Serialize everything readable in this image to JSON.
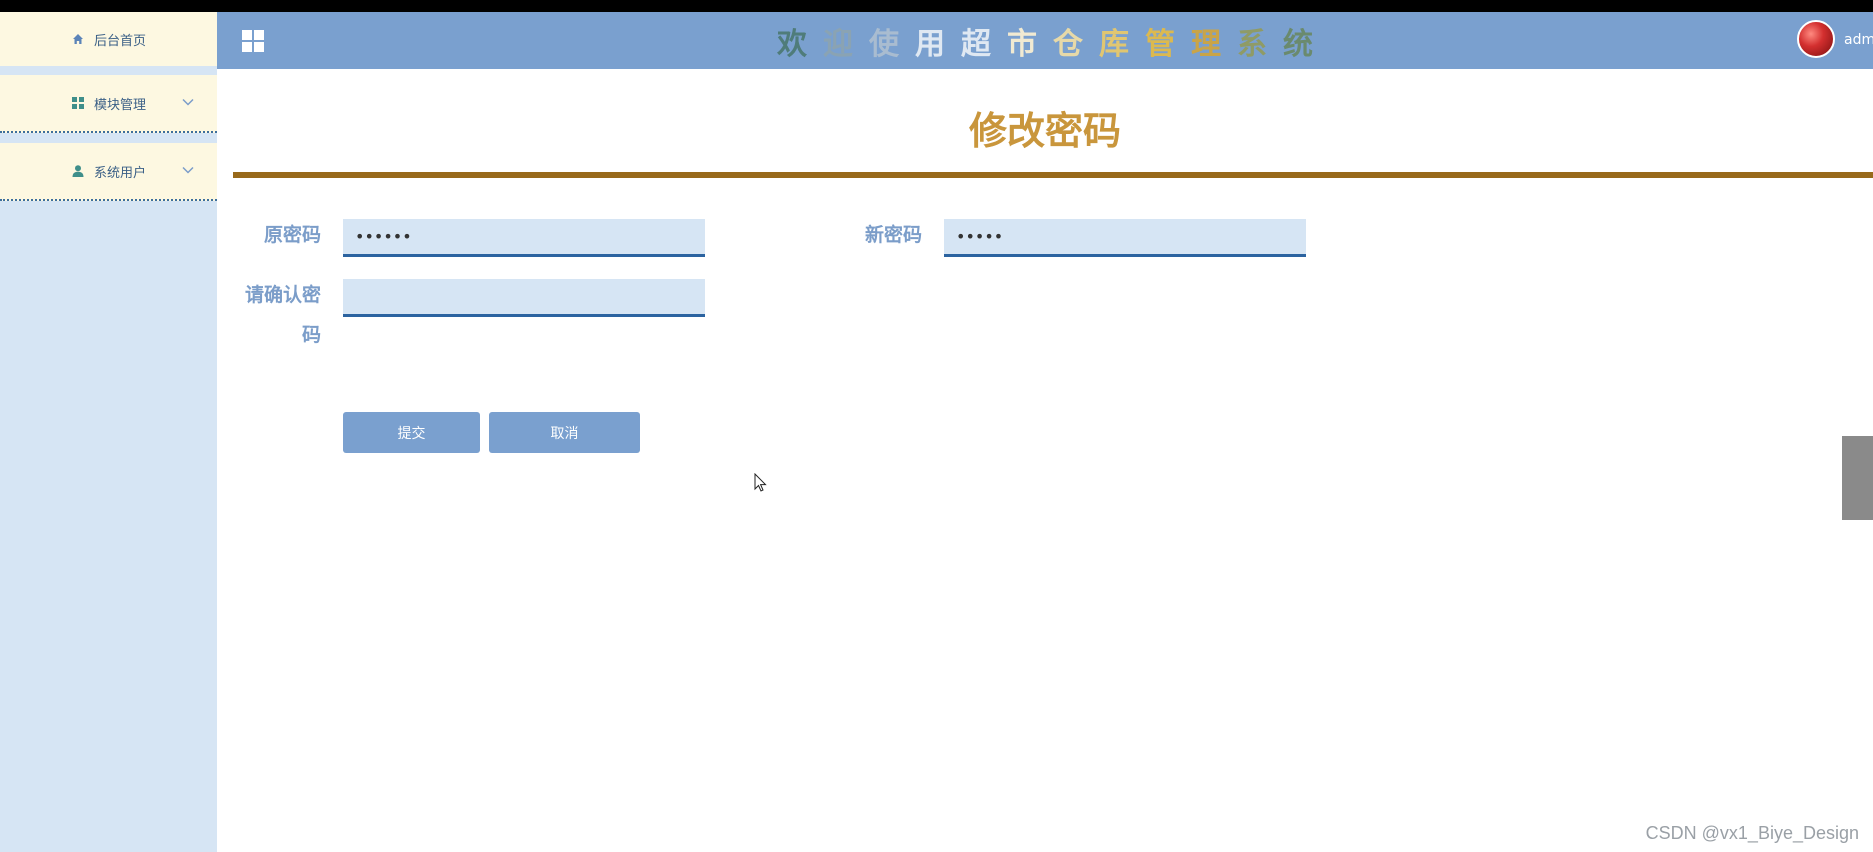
{
  "sidebar": {
    "items": [
      {
        "label": "后台首页",
        "icon": "home-icon"
      },
      {
        "label": "模块管理",
        "icon": "grid-icon"
      },
      {
        "label": "系统用户",
        "icon": "user-icon"
      }
    ]
  },
  "header": {
    "welcome_chars": [
      {
        "ch": "欢",
        "color": "#4f7c7a"
      },
      {
        "ch": "迎",
        "color": "#8aa3b3"
      },
      {
        "ch": "使",
        "color": "#a9bcd0"
      },
      {
        "ch": "用",
        "color": "#dfe8f2"
      },
      {
        "ch": "超",
        "color": "#dfe8f2"
      },
      {
        "ch": "市",
        "color": "#f1ead2"
      },
      {
        "ch": "仓",
        "color": "#e7d9a8"
      },
      {
        "ch": "库",
        "color": "#e0c671"
      },
      {
        "ch": "管",
        "color": "#dcb94f"
      },
      {
        "ch": "理",
        "color": "#c9a448"
      },
      {
        "ch": "系",
        "color": "#8f9b66"
      },
      {
        "ch": "统",
        "color": "#6a8a6e"
      }
    ],
    "username": "admi"
  },
  "form": {
    "title": "修改密码",
    "old_password_label": "原密码",
    "old_password_value": "••••••",
    "new_password_label": "新密码",
    "new_password_value": "•••••",
    "confirm_label_line1": "请确认密",
    "confirm_label_line2": "码",
    "confirm_value": "",
    "submit_label": "提交",
    "cancel_label": "取消"
  },
  "watermark": "CSDN @vx1_Biye_Design",
  "colors": {
    "header_bg": "#7aa0cf",
    "sidebar_bg": "#d6e5f4",
    "title_color": "#c9963c",
    "divider": "#98691a",
    "button_bg": "#7aa0cf"
  }
}
